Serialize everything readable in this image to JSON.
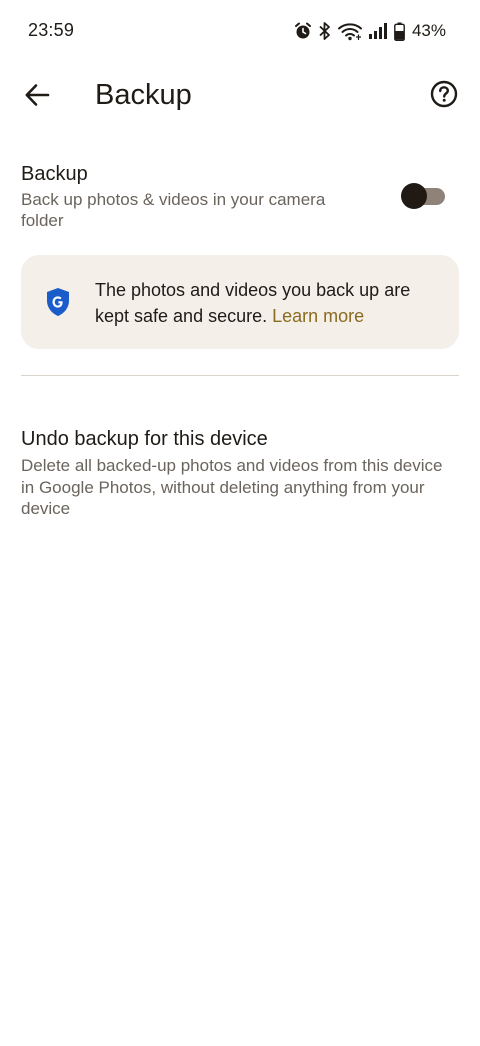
{
  "status_bar": {
    "time": "23:59",
    "battery_percent": "43%",
    "icons": [
      "alarm-icon",
      "bluetooth-icon",
      "wifi-icon",
      "cell-signal-icon",
      "battery-icon"
    ]
  },
  "app_bar": {
    "title": "Backup",
    "back_icon": "arrow-back-icon",
    "help_icon": "help-circle-icon"
  },
  "backup_setting": {
    "title": "Backup",
    "subtitle": "Back up photos & videos in your camera folder",
    "enabled": false
  },
  "info_card": {
    "text": "The photos and videos you back up are kept safe and secure.",
    "link": "Learn more",
    "icon": "google-shield-icon",
    "shield_color": "#1a5cc9"
  },
  "undo_backup": {
    "title": "Undo backup for this device",
    "subtitle": "Delete all backed-up photos and videos from this device in Google Photos, without deleting anything from your device"
  },
  "colors": {
    "text_primary": "#1f1b16",
    "text_secondary": "#6a645d",
    "card_background": "#f4efe8",
    "link": "#8a6a1f",
    "toggle_track": "#8e8279",
    "toggle_thumb": "#211a14"
  }
}
